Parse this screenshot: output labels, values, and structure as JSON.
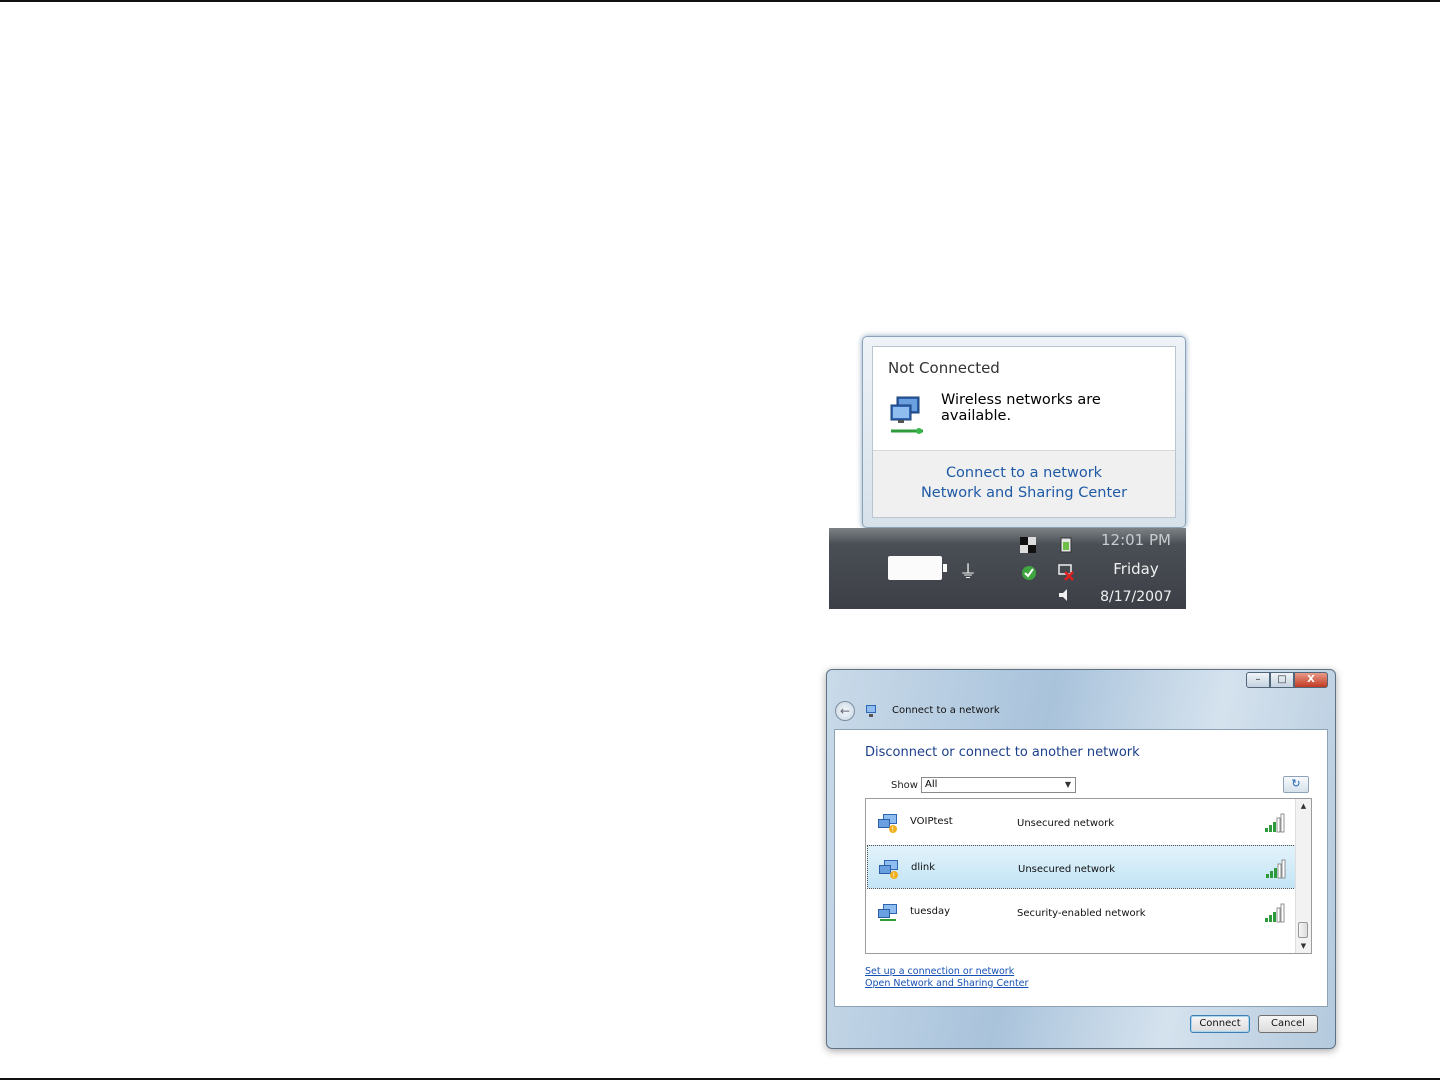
{
  "notification": {
    "title": "Not Connected",
    "message": "Wireless networks are available.",
    "links": [
      "Connect to a network",
      "Network and Sharing Center"
    ]
  },
  "tray": {
    "time": "12:01 PM",
    "day": "Friday",
    "date": "8/17/2007"
  },
  "dialog": {
    "window_title": "Connect to a network",
    "caption_buttons": [
      "–",
      "□",
      "X"
    ],
    "heading": "Disconnect or connect to another network",
    "show_label": "Show",
    "show_value": "All",
    "networks": [
      {
        "name": "VOIPtest",
        "status": "Unsecured network",
        "selected": false
      },
      {
        "name": "dlink",
        "status": "Unsecured network",
        "selected": true
      },
      {
        "name": "tuesday",
        "status": "Security-enabled network",
        "selected": false
      }
    ],
    "links": [
      "Set up a connection or network",
      "Open Network and Sharing Center"
    ],
    "connect_label": "Connect",
    "cancel_label": "Cancel"
  },
  "icons": {
    "network": "network-computer-icon",
    "signal": "signal-strength-icon",
    "back": "back-arrow-icon",
    "refresh": "refresh-icon",
    "plug": "power-plug-icon"
  }
}
